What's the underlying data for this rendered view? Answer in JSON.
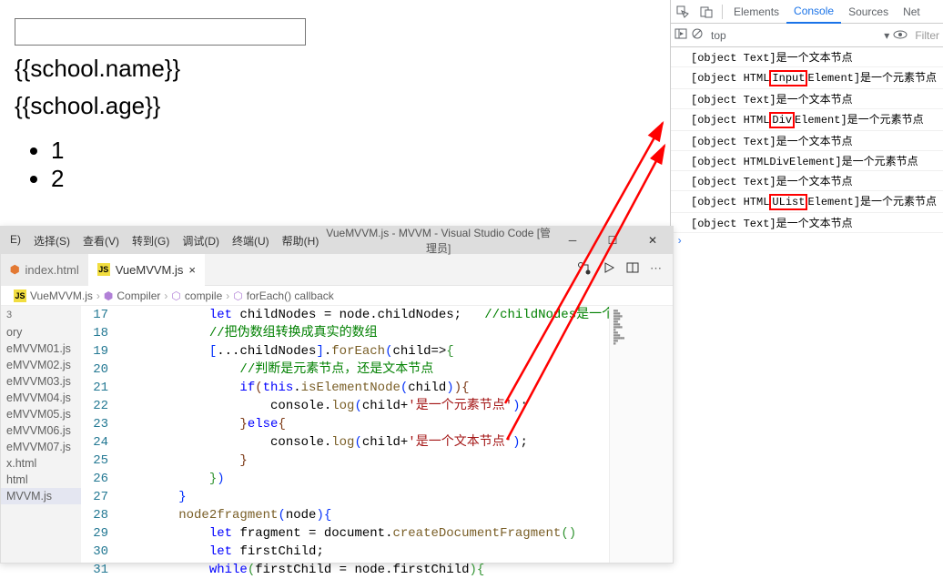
{
  "render": {
    "name_tpl": "{{school.name}}",
    "age_tpl": "{{school.age}}",
    "list": [
      "1",
      "2"
    ]
  },
  "devtools": {
    "tabs": [
      "Elements",
      "Console",
      "Sources",
      "Net"
    ],
    "active_tab": "Console",
    "context": "top",
    "filter_ph": "Filter",
    "lines": [
      {
        "plain": "[object Text]是一个文本节点"
      },
      {
        "pre": "[object HTML",
        "boxed": "Input",
        "post": "Element]是一个元素节点"
      },
      {
        "plain": "[object Text]是一个文本节点"
      },
      {
        "pre": "[object HTML",
        "boxed": "Div",
        "post": "Element]是一个元素节点"
      },
      {
        "plain": "[object Text]是一个文本节点"
      },
      {
        "plain": "[object HTMLDivElement]是一个元素节点"
      },
      {
        "plain": "[object Text]是一个文本节点"
      },
      {
        "pre": "[object HTML",
        "boxed": "UList",
        "post": "Element]是一个元素节点"
      },
      {
        "plain": "[object Text]是一个文本节点"
      }
    ]
  },
  "vscode": {
    "menus": [
      "E)",
      "选择(S)",
      "查看(V)",
      "转到(G)",
      "调试(D)",
      "终端(U)",
      "帮助(H)"
    ],
    "title": "VueMVVM.js - MVVM - Visual Studio Code [管理员]",
    "tab1": "index.html",
    "tab2": "VueMVVM.js",
    "breadcrumb": [
      "VueMVVM.js",
      "Compiler",
      "compile",
      "forEach() callback"
    ],
    "sidebar": {
      "head": "3",
      "items": [
        "ory",
        "eMVVM01.js",
        "eMVVM02.js",
        "eMVVM03.js",
        "eMVVM04.js",
        "eMVVM05.js",
        "eMVVM06.js",
        "eMVVM07.js",
        "x.html",
        "html",
        "MVVM.js"
      ]
    },
    "code": {
      "lines": [
        {
          "n": 17,
          "i": 3,
          "segs": [
            {
              "t": "let ",
              "c": "kw"
            },
            {
              "t": "childNodes = node.childNodes;   "
            },
            {
              "t": "//childNodes是一个伪数组",
              "c": "cmt"
            }
          ]
        },
        {
          "n": 18,
          "i": 3,
          "segs": [
            {
              "t": "//把伪数组转换成真实的数组",
              "c": "cmt"
            }
          ]
        },
        {
          "n": 19,
          "i": 3,
          "segs": [
            {
              "t": "[",
              "c": "par"
            },
            {
              "t": "...childNodes"
            },
            {
              "t": "]",
              "c": "par"
            },
            {
              "t": "."
            },
            {
              "t": "forEach",
              "c": "fn"
            },
            {
              "t": "(",
              "c": "par"
            },
            {
              "t": "child=>"
            },
            {
              "t": "{",
              "c": "par2"
            }
          ]
        },
        {
          "n": 20,
          "i": 4,
          "segs": [
            {
              "t": "//判断是元素节点，还是文本节点",
              "c": "cmt"
            }
          ]
        },
        {
          "n": 21,
          "i": 4,
          "segs": [
            {
              "t": "if",
              "c": "kw"
            },
            {
              "t": "(",
              "c": "par3"
            },
            {
              "t": "this",
              "c": "kw"
            },
            {
              "t": "."
            },
            {
              "t": "isElementNode",
              "c": "fn"
            },
            {
              "t": "(",
              "c": "par"
            },
            {
              "t": "child"
            },
            {
              "t": ")",
              "c": "par"
            },
            {
              "t": ")",
              "c": "par3"
            },
            {
              "t": "{",
              "c": "par3"
            }
          ]
        },
        {
          "n": 22,
          "i": 5,
          "segs": [
            {
              "t": "console."
            },
            {
              "t": "log",
              "c": "fn"
            },
            {
              "t": "(",
              "c": "par"
            },
            {
              "t": "child+"
            },
            {
              "t": "'是一个元素节点'",
              "c": "str"
            },
            {
              "t": ")",
              "c": "par"
            },
            {
              "t": ";"
            }
          ]
        },
        {
          "n": 23,
          "i": 4,
          "segs": [
            {
              "t": "}",
              "c": "par3"
            },
            {
              "t": "else",
              "c": "kw"
            },
            {
              "t": "{",
              "c": "par3"
            }
          ]
        },
        {
          "n": 24,
          "i": 5,
          "segs": [
            {
              "t": "console."
            },
            {
              "t": "log",
              "c": "fn"
            },
            {
              "t": "(",
              "c": "par"
            },
            {
              "t": "child+"
            },
            {
              "t": "'是一个文本节点'",
              "c": "str"
            },
            {
              "t": ")",
              "c": "par"
            },
            {
              "t": ";"
            }
          ]
        },
        {
          "n": 25,
          "i": 4,
          "segs": [
            {
              "t": "}",
              "c": "par3"
            }
          ]
        },
        {
          "n": 26,
          "i": 3,
          "segs": [
            {
              "t": "}",
              "c": "par2"
            },
            {
              "t": ")",
              "c": "par"
            }
          ]
        },
        {
          "n": 27,
          "i": 2,
          "segs": [
            {
              "t": "}",
              "c": "par"
            }
          ]
        },
        {
          "n": 28,
          "i": 2,
          "segs": [
            {
              "t": "node2fragment",
              "c": "fn"
            },
            {
              "t": "(",
              "c": "par"
            },
            {
              "t": "node"
            },
            {
              "t": ")",
              "c": "par"
            },
            {
              "t": "{",
              "c": "par"
            }
          ]
        },
        {
          "n": 29,
          "i": 3,
          "segs": [
            {
              "t": "let ",
              "c": "kw"
            },
            {
              "t": "fragment = document."
            },
            {
              "t": "createDocumentFragment",
              "c": "fn"
            },
            {
              "t": "(",
              "c": "par2"
            },
            {
              "t": ")",
              "c": "par2"
            }
          ]
        },
        {
          "n": 30,
          "i": 3,
          "segs": [
            {
              "t": "let ",
              "c": "kw"
            },
            {
              "t": "firstChild;"
            }
          ]
        },
        {
          "n": 31,
          "i": 3,
          "segs": [
            {
              "t": "while",
              "c": "kw"
            },
            {
              "t": "(",
              "c": "par2"
            },
            {
              "t": "firstChild = node.firstChild"
            },
            {
              "t": ")",
              "c": "par2"
            },
            {
              "t": "{",
              "c": "par2"
            }
          ]
        }
      ]
    }
  }
}
